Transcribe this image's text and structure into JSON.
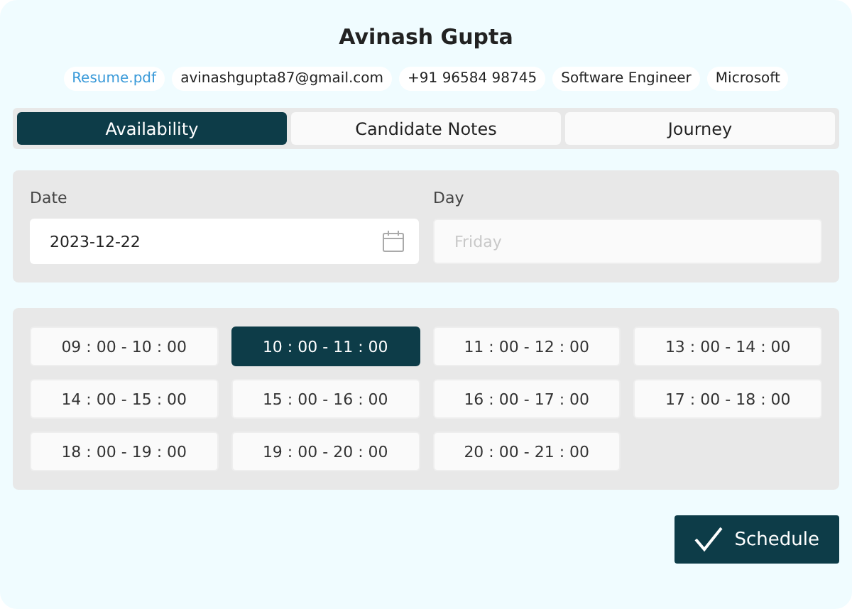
{
  "candidate": {
    "name": "Avinash Gupta"
  },
  "chips": [
    {
      "kind": "link",
      "text": "Resume.pdf"
    },
    {
      "kind": "text",
      "text": "avinashgupta87@gmail.com"
    },
    {
      "kind": "text",
      "text": "+91 96584 98745"
    },
    {
      "kind": "text",
      "text": "Software Engineer"
    },
    {
      "kind": "text",
      "text": "Microsoft"
    }
  ],
  "tabs": [
    {
      "label": "Availability",
      "selected": true
    },
    {
      "label": "Candidate Notes",
      "selected": false
    },
    {
      "label": "Journey",
      "selected": false
    }
  ],
  "date_field": {
    "label": "Date",
    "value": "2023-12-22"
  },
  "day_field": {
    "label": "Day",
    "placeholder": "Friday"
  },
  "slots": [
    {
      "label": "09 : 00 - 10 : 00",
      "selected": false
    },
    {
      "label": "10 : 00 - 11 : 00",
      "selected": true
    },
    {
      "label": "11 : 00 - 12 : 00",
      "selected": false
    },
    {
      "label": "13 : 00 - 14 : 00",
      "selected": false
    },
    {
      "label": "14 : 00 - 15 : 00",
      "selected": false
    },
    {
      "label": "15 : 00 - 16 : 00",
      "selected": false
    },
    {
      "label": "16 : 00 - 17 : 00",
      "selected": false
    },
    {
      "label": "17 : 00 - 18 : 00",
      "selected": false
    },
    {
      "label": "18 : 00 - 19 : 00",
      "selected": false
    },
    {
      "label": "19 : 00 - 20 : 00",
      "selected": false
    },
    {
      "label": "20 : 00 - 21 : 00",
      "selected": false
    }
  ],
  "schedule_button": {
    "label": "Schedule"
  }
}
